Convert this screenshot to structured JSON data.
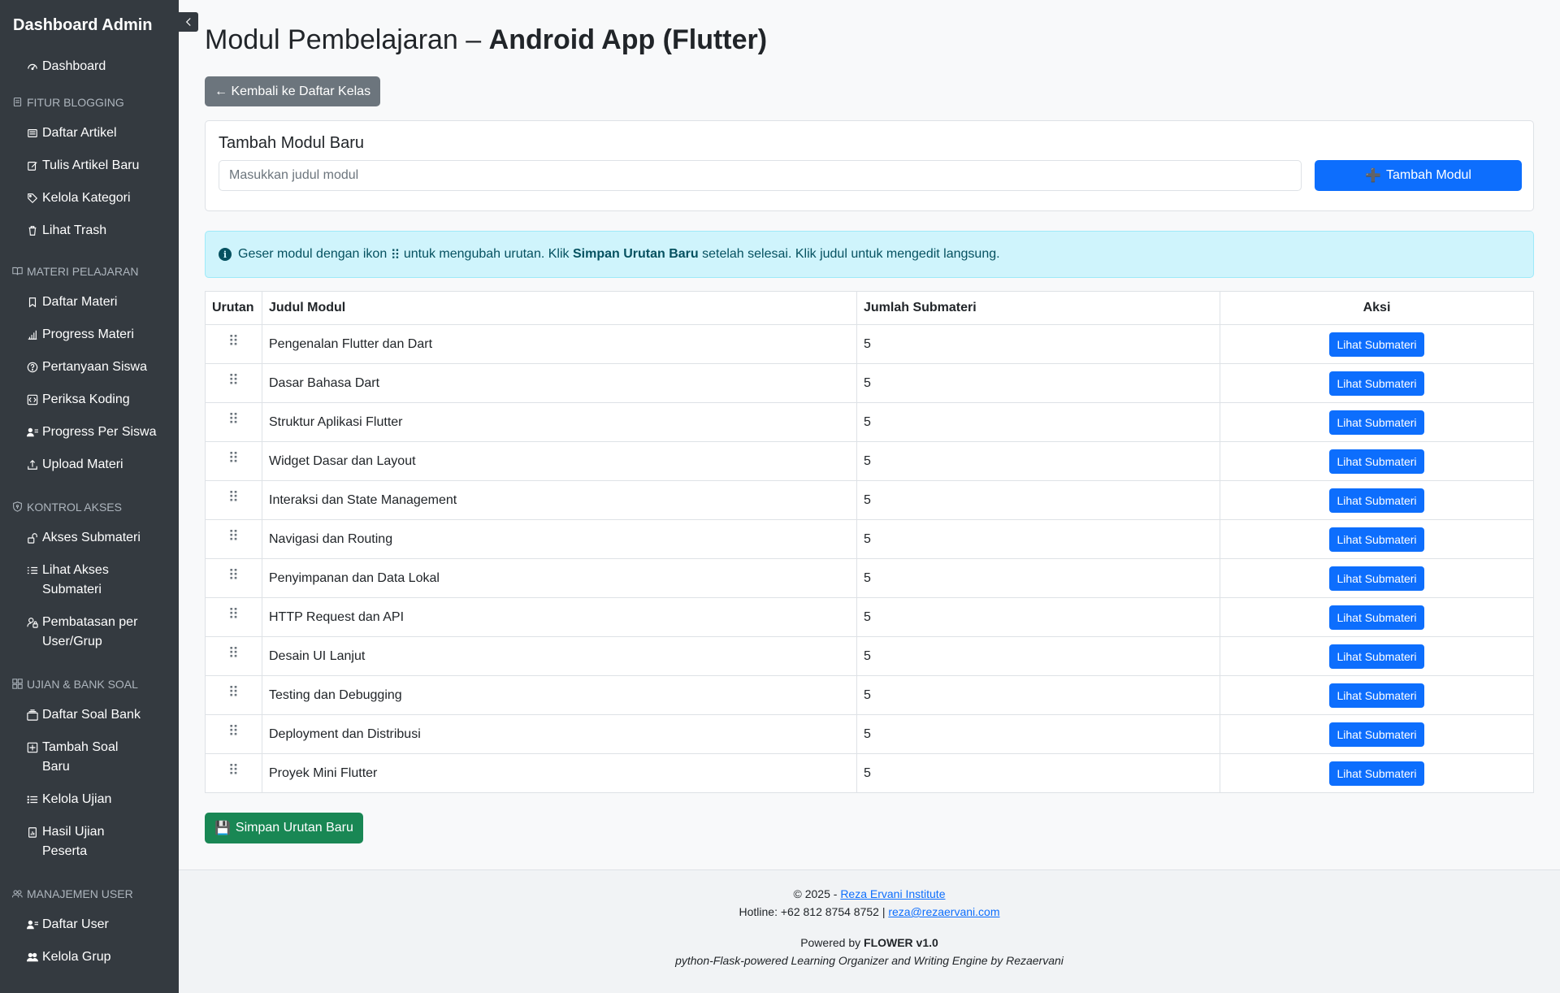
{
  "sidebar": {
    "brand": "Dashboard Admin",
    "dashboard": "Dashboard",
    "sections": {
      "blogging": "FITUR BLOGGING",
      "materi": "MATERI PELAJARAN",
      "akses": "KONTROL AKSES",
      "ujian": "UJIAN & BANK SOAL",
      "user": "MANAJEMEN USER"
    },
    "items": {
      "daftar_artikel": "Daftar Artikel",
      "tulis_artikel": "Tulis Artikel Baru",
      "kelola_kategori": "Kelola Kategori",
      "lihat_trash": "Lihat Trash",
      "daftar_materi": "Daftar Materi",
      "progress_materi": "Progress Materi",
      "pertanyaan_siswa": "Pertanyaan Siswa",
      "periksa_koding": "Periksa Koding",
      "progress_per_siswa": "Progress Per Siswa",
      "upload_materi": "Upload Materi",
      "akses_submateri": "Akses Submateri",
      "lihat_akses_submateri": "Lihat Akses Submateri",
      "pembatasan": "Pembatasan per User/Grup",
      "daftar_soal_bank": "Daftar Soal Bank",
      "tambah_soal_baru": "Tambah Soal Baru",
      "kelola_ujian": "Kelola Ujian",
      "hasil_ujian": "Hasil Ujian Peserta",
      "daftar_user": "Daftar User",
      "kelola_grup": "Kelola Grup"
    }
  },
  "header": {
    "title_prefix": "Modul Pembelajaran – ",
    "title_course": "Android App (Flutter)"
  },
  "back_button": "← Kembali ke Daftar Kelas",
  "add_card": {
    "title": "Tambah Modul Baru",
    "input_placeholder": "Masukkan judul modul",
    "button_icon": "➕",
    "button_label": "Tambah Modul"
  },
  "alert": {
    "part1": "Geser modul dengan ikon ",
    "handle": "⠿",
    "part2": " untuk mengubah urutan. Klik ",
    "bold": "Simpan Urutan Baru",
    "part3": " setelah selesai. Klik judul untuk mengedit langsung."
  },
  "table": {
    "headers": [
      "Urutan",
      "Judul Modul",
      "Jumlah Submateri",
      "Aksi"
    ],
    "handle_glyph": "⠿",
    "action_label": "Lihat Submateri",
    "rows": [
      {
        "title": "Pengenalan Flutter dan Dart",
        "count": "5"
      },
      {
        "title": "Dasar Bahasa Dart",
        "count": "5"
      },
      {
        "title": "Struktur Aplikasi Flutter",
        "count": "5"
      },
      {
        "title": "Widget Dasar dan Layout",
        "count": "5"
      },
      {
        "title": "Interaksi dan State Management",
        "count": "5"
      },
      {
        "title": "Navigasi dan Routing",
        "count": "5"
      },
      {
        "title": "Penyimpanan dan Data Lokal",
        "count": "5"
      },
      {
        "title": "HTTP Request dan API",
        "count": "5"
      },
      {
        "title": "Desain UI Lanjut",
        "count": "5"
      },
      {
        "title": "Testing dan Debugging",
        "count": "5"
      },
      {
        "title": "Deployment dan Distribusi",
        "count": "5"
      },
      {
        "title": "Proyek Mini Flutter",
        "count": "5"
      }
    ]
  },
  "save_button": {
    "icon": "💾",
    "label": "Simpan Urutan Baru"
  },
  "footer": {
    "copyright_prefix": "© 2025 - ",
    "institute": "Reza Ervani Institute",
    "hotline_prefix": "Hotline: +62 812 8754 8752 | ",
    "email": "reza@rezaervani.com",
    "powered_prefix": "Powered by ",
    "powered_name": "FLOWER v1.0",
    "tagline": "python-Flask-powered Learning Organizer and Writing Engine by Rezaervani"
  },
  "colors": {
    "sidebar_bg": "#343a40",
    "primary": "#0d6efd",
    "secondary": "#6c757d",
    "success": "#198754",
    "info_bg": "#cff4fc",
    "info_text": "#055160"
  }
}
